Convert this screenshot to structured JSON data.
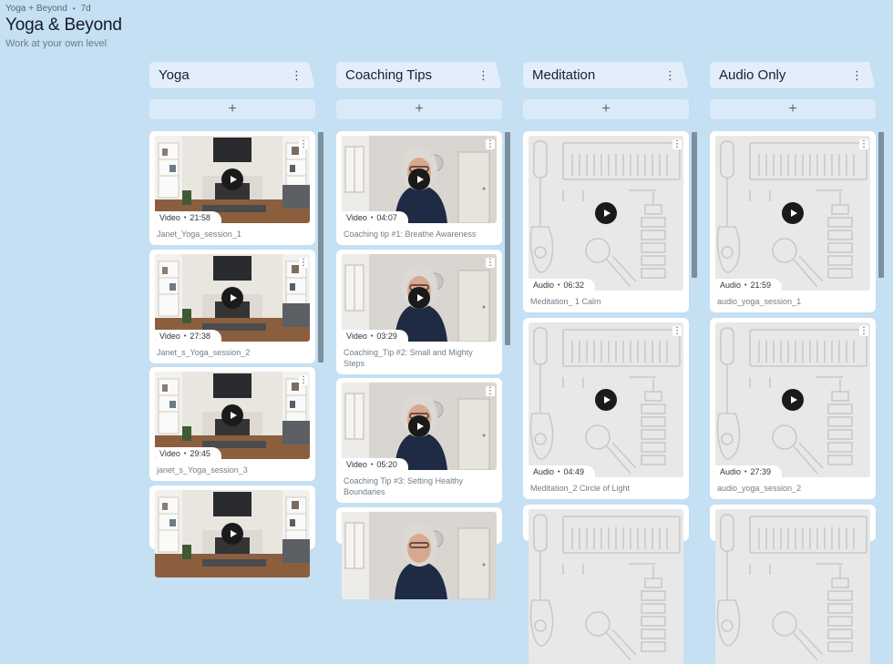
{
  "header": {
    "breadcrumb": "Yoga + Beyond",
    "age": "7d",
    "title": "Yoga & Beyond",
    "subtitle": "Work at your own level"
  },
  "add_symbol": "+",
  "kebab_symbol": "⋮",
  "columns": [
    {
      "name": "Yoga",
      "cards": [
        {
          "type": "Video",
          "duration": "21:58",
          "caption": "Janet_Yoga_session_1"
        },
        {
          "type": "Video",
          "duration": "27:38",
          "caption": "Janet_s_Yoga_session_2"
        },
        {
          "type": "Video",
          "duration": "29:45",
          "caption": "janet_s_Yoga_session_3"
        }
      ]
    },
    {
      "name": "Coaching Tips",
      "cards": [
        {
          "type": "Video",
          "duration": "04:07",
          "caption": "Coaching tip #1: Breathe Awareness"
        },
        {
          "type": "Video",
          "duration": "03:29",
          "caption": "Coaching_Tip #2: Small and Mighty Steps"
        },
        {
          "type": "Video",
          "duration": "05:20",
          "caption": "Coaching Tip #3: Setting Healthy Boundaries"
        }
      ]
    },
    {
      "name": "Meditation",
      "cards": [
        {
          "type": "Audio",
          "duration": "06:32",
          "caption": "Meditation_ 1 Calm"
        },
        {
          "type": "Audio",
          "duration": "04:49",
          "caption": "Meditation_2 Circle of Light"
        }
      ]
    },
    {
      "name": "Audio Only",
      "cards": [
        {
          "type": "Audio",
          "duration": "21:59",
          "caption": "audio_yoga_session_1"
        },
        {
          "type": "Audio",
          "duration": "27:39",
          "caption": "audio_yoga_session_2"
        }
      ]
    }
  ],
  "colors": {
    "background": "#c5dff3",
    "card": "#ffffff",
    "column_header": "#e2eef9",
    "scrollbar": "#7d8e9c",
    "play_button": "#1a1a1a"
  }
}
